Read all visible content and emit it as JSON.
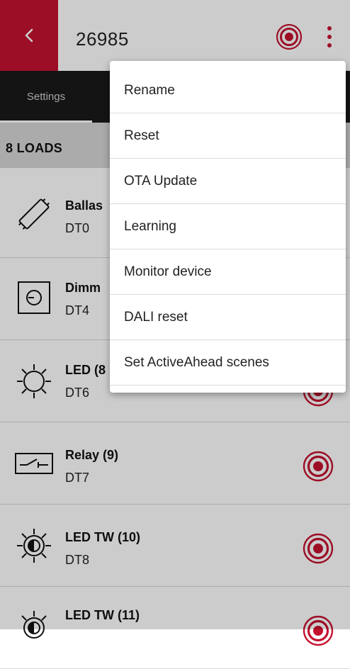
{
  "header": {
    "title": "26985",
    "back_icon": "chevron-left-icon",
    "identify_icon": "target-icon",
    "more_icon": "more-vertical-icon"
  },
  "tabs": [
    {
      "label": "Settings"
    }
  ],
  "section": {
    "title": "8 LOADS"
  },
  "loads": [
    {
      "name": "Ballas",
      "type": "DT0",
      "icon": "ballast-tube-icon"
    },
    {
      "name": "Dimm",
      "type": "DT4",
      "icon": "dimmer-icon"
    },
    {
      "name": "LED (8",
      "type": "DT6",
      "icon": "led-bulb-icon"
    },
    {
      "name": "Relay (9)",
      "type": "DT7",
      "icon": "relay-switch-icon"
    },
    {
      "name": "LED TW (10)",
      "type": "DT8",
      "icon": "led-tw-icon"
    },
    {
      "name": "LED TW (11)",
      "type": "",
      "icon": "led-tw-icon"
    }
  ],
  "menu": {
    "items": [
      {
        "label": "Rename"
      },
      {
        "label": "Reset"
      },
      {
        "label": "OTA Update"
      },
      {
        "label": "Learning"
      },
      {
        "label": "Monitor device"
      },
      {
        "label": "DALI reset"
      },
      {
        "label": "Set ActiveAhead scenes"
      }
    ]
  },
  "colors": {
    "accent": "#c4122f",
    "tabbar": "#1a1a1a",
    "section_bg": "#d6d6d6"
  }
}
